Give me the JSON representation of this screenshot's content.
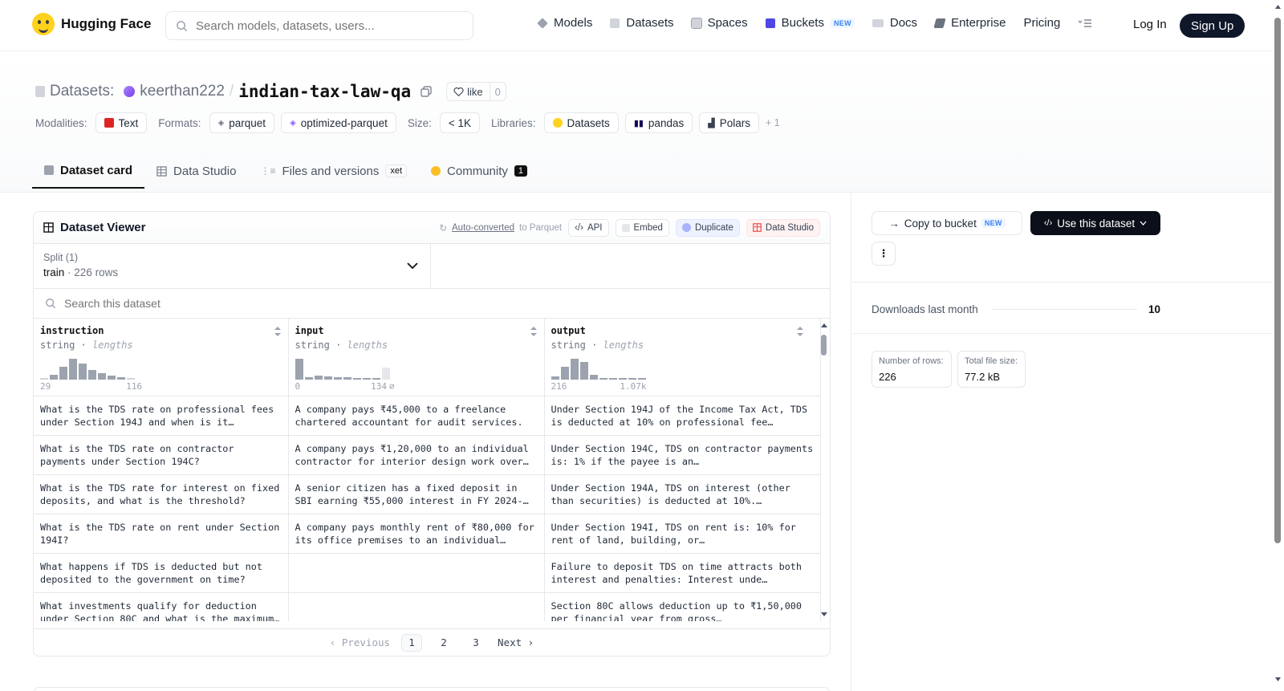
{
  "nav": {
    "brand": "Hugging Face",
    "search_placeholder": "Search models, datasets, users...",
    "links": [
      "Models",
      "Datasets",
      "Spaces",
      "Buckets",
      "Docs",
      "Enterprise",
      "Pricing"
    ],
    "buckets_badge": "NEW",
    "login": "Log In",
    "signup": "Sign Up"
  },
  "header": {
    "prefix": "Datasets:",
    "owner": "keerthan222",
    "separator": "/",
    "repo": "indian-tax-law-qa",
    "like_label": "like",
    "like_count": "0",
    "modalities_label": "Modalities:",
    "modality": "Text",
    "formats_label": "Formats:",
    "formats": [
      "parquet",
      "optimized-parquet"
    ],
    "size_label": "Size:",
    "size": "< 1K",
    "libraries_label": "Libraries:",
    "libraries": [
      "Datasets",
      "pandas",
      "Polars"
    ],
    "libraries_more": "+ 1"
  },
  "tabs": {
    "card": "Dataset card",
    "studio": "Data Studio",
    "files": "Files and versions",
    "xet": "xet",
    "community": "Community",
    "community_count": "1"
  },
  "viewer": {
    "title": "Dataset Viewer",
    "auto_converted": "Auto-converted",
    "to_parquet": "to Parquet",
    "api": "API",
    "embed": "Embed",
    "duplicate": "Duplicate",
    "data_studio": "Data Studio",
    "split_label": "Split (1)",
    "split_name": "train",
    "split_dot": "·",
    "split_rows": "226 rows",
    "search_placeholder": "Search this dataset",
    "columns": [
      {
        "name": "instruction",
        "type": "string",
        "stat": "lengths",
        "min": "29",
        "max": "116"
      },
      {
        "name": "input",
        "type": "string",
        "stat": "lengths",
        "min": "0",
        "max": "134"
      },
      {
        "name": "output",
        "type": "string",
        "stat": "lengths",
        "min": "216",
        "max": "1.07k"
      }
    ],
    "rows": [
      [
        "What is the TDS rate on professional fees under Section 194J and when is it…",
        "A company pays ₹45,000 to a freelance chartered accountant for audit services.",
        "Under Section 194J of the Income Tax Act, TDS is deducted at 10% on professional fee…"
      ],
      [
        "What is the TDS rate on contractor payments under Section 194C?",
        "A company pays ₹1,20,000 to an individual contractor for interior design work over…",
        "Under Section 194C, TDS on contractor payments is: 1% if the payee is an…"
      ],
      [
        "What is the TDS rate for interest on fixed deposits, and what is the threshold?",
        "A senior citizen has a fixed deposit in SBI earning ₹55,000 interest in FY 2024-…",
        "Under Section 194A, TDS on interest (other than securities) is deducted at 10%.…"
      ],
      [
        "What is the TDS rate on rent under Section 194I?",
        "A company pays monthly rent of ₹80,000 for its office premises to an individual…",
        "Under Section 194I, TDS on rent is: 10% for rent of land, building, or…"
      ],
      [
        "What happens if TDS is deducted but not deposited to the government on time?",
        "",
        "Failure to deposit TDS on time attracts both interest and penalties: Interest unde…"
      ],
      [
        "What investments qualify for deduction under Section 80C and what is the maximum…",
        "",
        "Section 80C allows deduction up to ₹1,50,000 per financial year from gross…"
      ]
    ],
    "pager": {
      "prev": "Previous",
      "pages": [
        "1",
        "2",
        "3"
      ],
      "next": "Next"
    }
  },
  "sidebar": {
    "copy_bucket": "Copy to bucket",
    "copy_badge": "NEW",
    "use_dataset": "Use this dataset",
    "more": "⋮",
    "downloads_label": "Downloads last month",
    "downloads": "10",
    "rows_label": "Number of rows:",
    "rows": "226",
    "size_label": "Total file size:",
    "size": "77.2 kB"
  }
}
